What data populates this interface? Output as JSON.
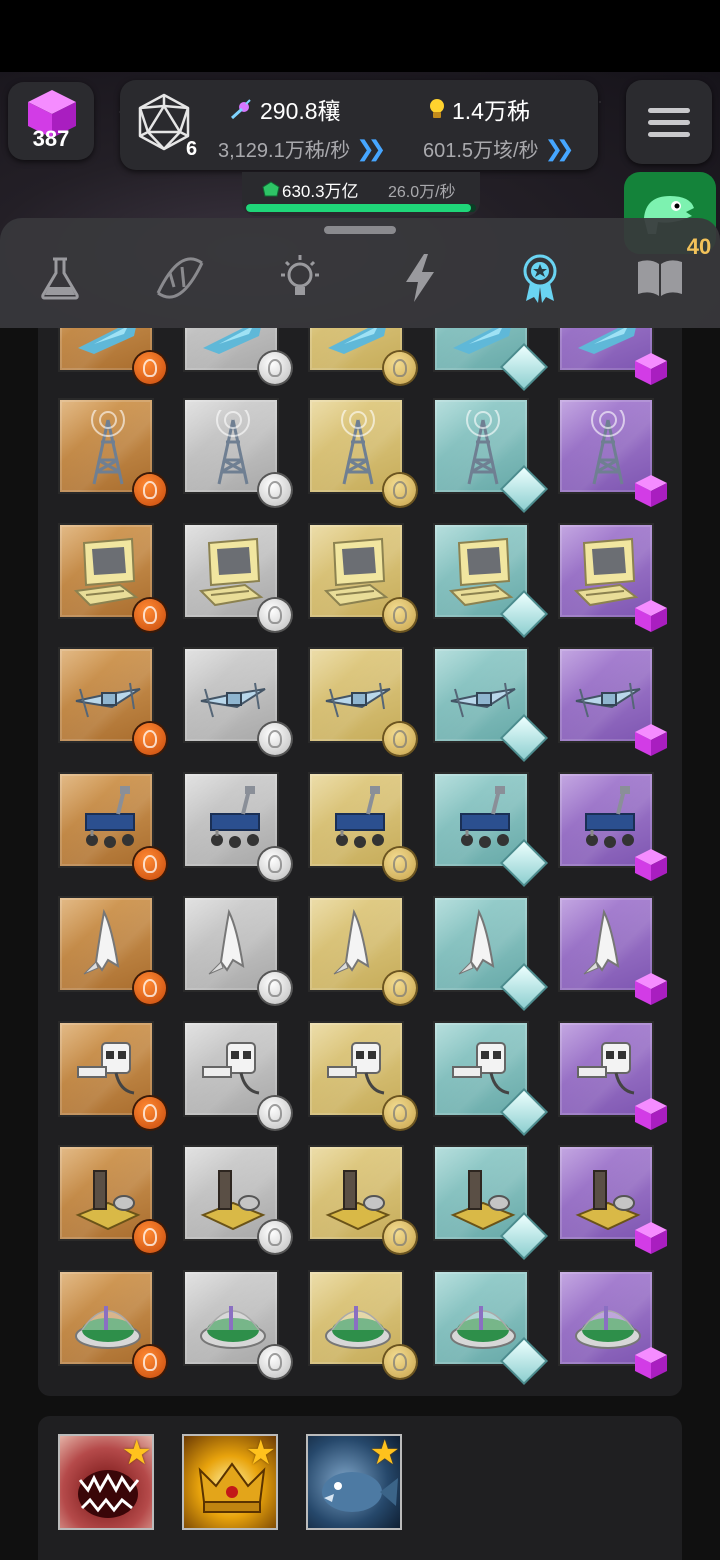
{
  "header": {
    "cube_count": "387",
    "d20_count": "6",
    "stat_particles": "290.8穰",
    "stat_particles_rate": "3,129.1万秭/秒",
    "stat_ideas": "1.4万秭",
    "stat_ideas_rate": "601.5万垓/秒",
    "gem_value": "630.3万亿",
    "gem_rate": "26.0万/秒",
    "gem_progress": 0.98,
    "level_badge": "40"
  },
  "tabs": [
    {
      "name": "science",
      "icon": "flask-icon"
    },
    {
      "name": "dna",
      "icon": "dna-icon"
    },
    {
      "name": "ideas",
      "icon": "lightbulb-icon"
    },
    {
      "name": "power",
      "icon": "lightning-icon"
    },
    {
      "name": "achievements",
      "icon": "medal-icon",
      "active": true
    },
    {
      "name": "book",
      "icon": "book-icon"
    }
  ],
  "grid": {
    "tiers": [
      "bronze",
      "silver",
      "gold",
      "diamond",
      "amethyst"
    ],
    "rows": [
      {
        "item": "starship",
        "partial": true
      },
      {
        "item": "radio-tower"
      },
      {
        "item": "computer"
      },
      {
        "item": "satellite"
      },
      {
        "item": "rover"
      },
      {
        "item": "space-shuttle"
      },
      {
        "item": "robot"
      },
      {
        "item": "observatory"
      },
      {
        "item": "dome-city"
      }
    ]
  },
  "bosses": [
    {
      "name": "shark",
      "icon": "shark-icon"
    },
    {
      "name": "crown",
      "icon": "crown-icon"
    },
    {
      "name": "fish",
      "icon": "fish-icon"
    }
  ],
  "colors": {
    "accent_blue": "#46a6ff",
    "progress_green": "#1fd679",
    "cube_magenta": "#e24df0",
    "star_gold": "#ffc21d"
  }
}
